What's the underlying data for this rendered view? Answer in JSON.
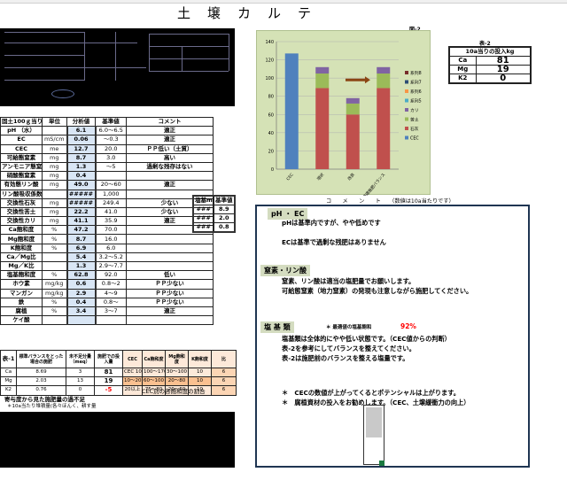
{
  "title": "土　壌　カ　ル　テ",
  "soil_table": {
    "headers": [
      "固土100ｇ当り",
      "単位",
      "分析値",
      "基準値",
      "コメント"
    ],
    "rows": [
      {
        "name": "pH （水）",
        "unit": "",
        "value": "6.1",
        "std": "6.0～6.5",
        "comment": "適正"
      },
      {
        "name": "EC",
        "unit": "mS/cm",
        "value": "0.06",
        "std": "～0.3",
        "comment": "適正"
      },
      {
        "name": "CEC",
        "unit": "me",
        "value": "12.7",
        "std": "20.0",
        "comment": "ＰＰ低い（土質）"
      },
      {
        "name": "可給態窒素",
        "unit": "mg",
        "value": "8.7",
        "std": "3.0",
        "comment": "高い"
      },
      {
        "name": "アンモニア態窒",
        "unit": "mg",
        "value": "1.3",
        "std": "～5",
        "comment": "過剰な残存はない"
      },
      {
        "name": "硝酸態窒素",
        "unit": "mg",
        "value": "0.4",
        "std": "",
        "comment": ""
      },
      {
        "name": "有効態リン酸",
        "unit": "mg",
        "value": "49.0",
        "std": "20～60",
        "comment": "適正"
      },
      {
        "name": "リン酸吸収係数",
        "unit": "",
        "value": "#####",
        "std": "1,000",
        "comment": ""
      },
      {
        "name": "交換性石灰",
        "unit": "mg",
        "value": "#####",
        "std": "249.4",
        "comment": "少ない"
      },
      {
        "name": "交換性苦土",
        "unit": "mg",
        "value": "22.2",
        "std": "41.0",
        "comment": "少ない"
      },
      {
        "name": "交換性カリ",
        "unit": "mg",
        "value": "41.1",
        "std": "35.9",
        "comment": "適正"
      },
      {
        "name": "Ca飽和度",
        "unit": "%",
        "value": "47.2",
        "std": "70.0",
        "comment": ""
      },
      {
        "name": "Mg飽和度",
        "unit": "%",
        "value": "8.7",
        "std": "16.0",
        "comment": ""
      },
      {
        "name": "K飽和度",
        "unit": "%",
        "value": "6.9",
        "std": "6.0",
        "comment": ""
      },
      {
        "name": "Ca／Mg比",
        "unit": "",
        "value": "5.4",
        "std": "3.2～5.2",
        "comment": ""
      },
      {
        "name": "Mg／K比",
        "unit": "",
        "value": "1.3",
        "std": "2.9～7.7",
        "comment": ""
      },
      {
        "name": "塩基飽和度",
        "unit": "%",
        "value": "62.8",
        "std": "92.0",
        "comment": "低い"
      },
      {
        "name": "ホウ素",
        "unit": "mg/kg",
        "value": "0.6",
        "std": "0.8～2",
        "comment": "ＰＰ少ない"
      },
      {
        "name": "マンガン",
        "unit": "mg/kg",
        "value": "2.9",
        "std": "4～9",
        "comment": "ＰＰ少ない"
      },
      {
        "name": "鉄",
        "unit": "%",
        "value": "0.4",
        "std": "0.8～",
        "comment": "ＰＰ少ない"
      },
      {
        "name": "腐植",
        "unit": "%",
        "value": "3.4",
        "std": "3～7",
        "comment": "適正"
      },
      {
        "name": "ケイ酸",
        "unit": "",
        "value": "",
        "std": "",
        "comment": ""
      }
    ],
    "side": {
      "headers": [
        "塩基me",
        "基準値"
      ],
      "rows": [
        [
          "###",
          "8.9"
        ],
        [
          "###",
          "2.0"
        ],
        [
          "###",
          "0.8"
        ]
      ]
    }
  },
  "balance_table": {
    "corner": "表-1",
    "headers": [
      "標準バランスをとった場合の施肥",
      "未不足分量（meq）",
      "施肥での投入量",
      "CEC",
      "Ca飽和度",
      "Mg飽和度",
      "K飽和度",
      "比"
    ],
    "rows": [
      {
        "name": "Ca",
        "a": "8.69",
        "b": "3",
        "c": "81",
        "d": "CEC 10 ～",
        "e": "100～170",
        "f": "30～100",
        "g": "10",
        "h": "6"
      },
      {
        "name": "Mg",
        "a": "2.03",
        "b": "13",
        "c": "19",
        "d": "10～20",
        "e": "60～100",
        "f": "20～80",
        "g": "10",
        "h": "6"
      },
      {
        "name": "K2",
        "a": "0.76",
        "b": "0",
        "c": "-5",
        "d": "20以上",
        "e": "75～80",
        "f": "20～60",
        "g": "10",
        "h": "6"
      }
    ],
    "caption": "CEC別の各飽和度の割合",
    "footnote1": "寄与度から見た施肥量の過不足",
    "footnote2": "＊10a当たり堆積量(各々ほんく、耕す量"
  },
  "chart": {
    "fig_label": "図-2",
    "yticks": [
      0,
      20,
      40,
      60,
      80,
      100,
      120,
      140
    ],
    "ylim": [
      0,
      140
    ],
    "categories": [
      "CEC",
      "現状",
      "改良",
      "最適施肥バランス"
    ],
    "series": [
      {
        "name": "CEC",
        "color": "#4f81bd",
        "values": [
          127,
          0,
          0,
          0
        ]
      },
      {
        "name": "石灰",
        "color": "#c0504d",
        "values": [
          0,
          89,
          60,
          89
        ]
      },
      {
        "name": "苦土",
        "color": "#9bbb59",
        "values": [
          0,
          16,
          12,
          16
        ]
      },
      {
        "name": "カリ",
        "color": "#8064a2",
        "values": [
          0,
          7,
          6,
          7
        ]
      },
      {
        "name": "系列5",
        "color": "#4bacc6",
        "values": [
          0,
          0,
          0,
          0
        ]
      },
      {
        "name": "系列6",
        "color": "#f79646",
        "values": [
          0,
          0,
          0,
          0
        ]
      },
      {
        "name": "系列7",
        "color": "#2c4d75",
        "values": [
          0,
          0,
          0,
          0
        ]
      },
      {
        "name": "系列8",
        "color": "#772c2a",
        "values": [
          0,
          0,
          0,
          0
        ]
      }
    ],
    "legend": [
      "系列8",
      "系列7",
      "系列6",
      "系列5",
      "カリ",
      "苦土",
      "石灰",
      "CEC"
    ]
  },
  "input_table": {
    "title": "表-2",
    "header": "10a当りの投入kg",
    "rows": [
      [
        "Ca",
        "81"
      ],
      [
        "Mg",
        "19"
      ],
      [
        "K2",
        "0"
      ]
    ]
  },
  "comment_header": "コ　　メ　　ン　　ト　　（数値は10a当たりです）",
  "notes": {
    "ph_title": "pH ・ EC",
    "ph_1": "pHは基準内ですが、やや低めです",
    "ph_2": "ECは基準で過剰な残肥はありません",
    "n_title": "窒素・リン酸",
    "n_1": "窒素、リン酸は適当の塩肥量でお願いします。",
    "n_2": "可給態窒素（地力窒素）の発現も注意しながら施肥してください。",
    "b_title": "塩 基 類",
    "b_sub": "＊ 最適値の塩基飽和",
    "b_pct": "92%",
    "b_1": "塩基類は全体的にやや低い状態です。（CEC値からの判断）",
    "b_2": "表-2を参考にしてバランスを整えてください。",
    "b_3": "表-2は施肥前のバランスを整える塩量です。",
    "f_1": "＊　CECの数値が上がってくるとポテンシャルは上がります。",
    "f_2": "＊　腐植資材の投入をお勧めします。（CEC、土壌緩衝力の向上）"
  },
  "colors": {
    "value_bg": "#d9e6f5",
    "chart_bg": "#d5e2b6",
    "note_border": "#1f3552",
    "pct": "#ff0000",
    "arrow": "#8b4513"
  }
}
